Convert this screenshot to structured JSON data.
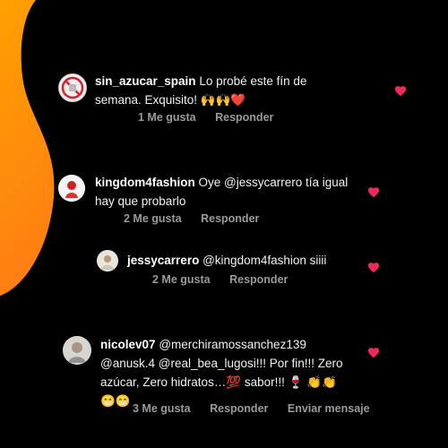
{
  "colors": {
    "background": "#000000",
    "accent_orange": "#FF8A00",
    "accent_pink": "#F0337A",
    "heart": "#ED2A5B",
    "meta_text": "#9A9A9A"
  },
  "comments": [
    {
      "username": "sin_azucar_spain",
      "text_line1": "Lo probé este fín de",
      "text_line2": "semana. Exquisito! 🙌🙌❤️",
      "likes": "1 Me gusta",
      "reply": "Responder",
      "liked": true
    },
    {
      "username": "kingdom4fashion",
      "text_line1": "Oye @jessycarrero tía igual",
      "text_line2": "hay que probarlo",
      "likes": "2 Me gusta",
      "reply": "Responder",
      "liked": true
    },
    {
      "username": "jessycarrero",
      "text_line1": "@kingdom4fashion siiii",
      "likes": "2 Me gusta",
      "reply": "Responder",
      "liked": true
    },
    {
      "username": "nicolev07",
      "text_line1": "@merchiramossanchez139",
      "text_line2": "@anusk.4 @real_bea_lugosi!!! Por fin!!! Zero",
      "text_line3": "azúcar, Zero hidratos…💯 sabor!!! 🍷 👏👏",
      "text_line4": "😁😁",
      "likes": "3 Me gusta",
      "reply": "Responder",
      "send_message": "Enviar mensaje",
      "liked": true
    }
  ],
  "icons": [
    "heart-icon",
    "avatar"
  ]
}
